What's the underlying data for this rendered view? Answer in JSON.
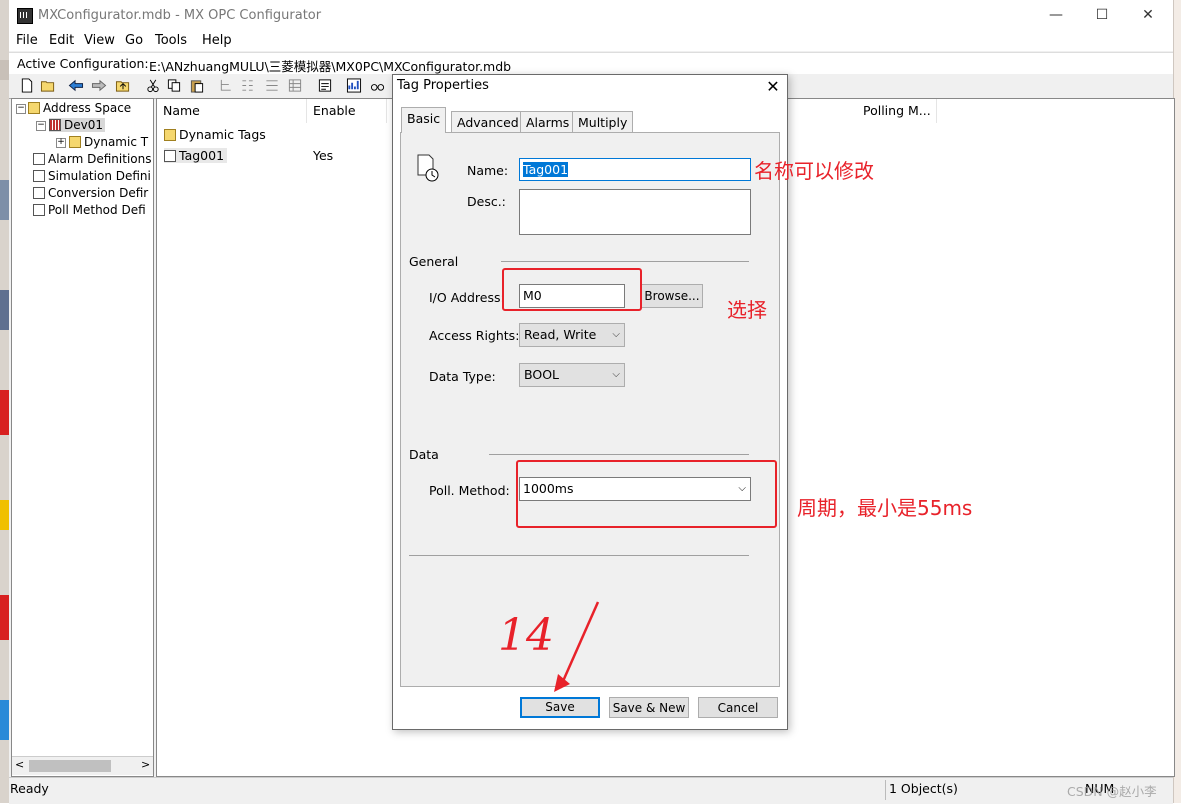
{
  "window": {
    "title": "MXConfigurator.mdb - MX OPC Configurator",
    "min": "—",
    "max": "☐",
    "close": "✕"
  },
  "menu": [
    "File",
    "Edit",
    "View",
    "Go",
    "Tools",
    "Help"
  ],
  "active_config": {
    "label": "Active Configuration:",
    "path": "E:\\ANzhuangMULU\\三菱模拟器\\MX0PC\\MXConfigurator.mdb"
  },
  "tree": {
    "items": [
      {
        "label": "Address Space"
      },
      {
        "label": "Dev01"
      },
      {
        "label": "Dynamic T"
      },
      {
        "label": "Alarm Definitions"
      },
      {
        "label": "Simulation Defini"
      },
      {
        "label": "Conversion Defir"
      },
      {
        "label": "Poll Method Defi"
      }
    ]
  },
  "list": {
    "columns": [
      "Name",
      "Enable",
      "Polling M..."
    ],
    "rows": [
      {
        "name": "Dynamic Tags",
        "enable": ""
      },
      {
        "name": "Tag001",
        "enable": "Yes"
      }
    ]
  },
  "status": {
    "left": "Ready",
    "objects": "1 Object(s)",
    "num": "NUM",
    "watermark": "CSDN @赵小李"
  },
  "dialog": {
    "title": "Tag Properties",
    "close": "✕",
    "tabs": [
      "Basic",
      "Advanced",
      "Alarms",
      "Multiply"
    ],
    "active_tab": "Basic",
    "name_label": "Name:",
    "name_value": "Tag001",
    "desc_label": "Desc.:",
    "desc_value": "",
    "general_label": "General",
    "io_label": "I/O Address:",
    "io_value": "M0",
    "browse_label": "Browse...",
    "access_label": "Access Rights:",
    "access_value": "Read, Write",
    "datatype_label": "Data Type:",
    "datatype_value": "BOOL",
    "data_label": "Data",
    "poll_label": "Poll. Method:",
    "poll_value": "1000ms",
    "save_label": "Save",
    "save_new_label": "Save & New",
    "cancel_label": "Cancel"
  },
  "annotations": {
    "name_note": "名称可以修改",
    "select_note": "选择",
    "period_note": "周期，最小是55ms",
    "step_number": "14"
  },
  "colors": {
    "annotation_red": "#e8222a",
    "selection_blue": "#0078d7"
  }
}
